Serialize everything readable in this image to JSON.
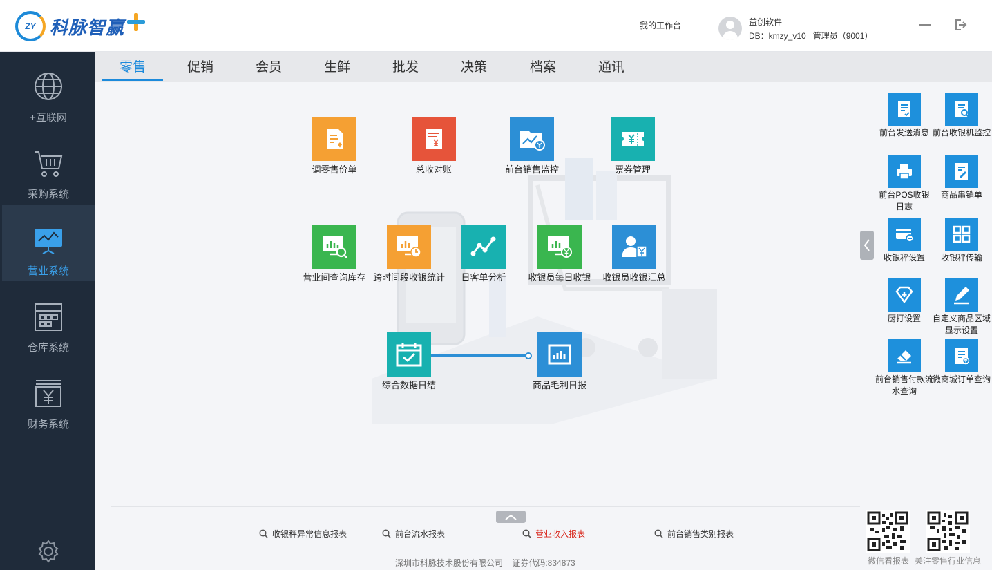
{
  "header": {
    "brand": "科脉智赢",
    "logo_mark": "ZY",
    "workbench_label": "我的工作台",
    "company_name": "益创软件",
    "db_info": "DB：kmzy_v10   管理员（9001）"
  },
  "sidebar": {
    "items": [
      {
        "label": "+互联网",
        "icon": "globe-icon"
      },
      {
        "label": "采购系统",
        "icon": "cart-icon"
      },
      {
        "label": "营业系统",
        "icon": "presentation-board-icon",
        "active": true
      },
      {
        "label": "仓库系统",
        "icon": "warehouse-icon"
      },
      {
        "label": "财务系统",
        "icon": "yen-ledger-icon"
      }
    ]
  },
  "tabs": [
    "零售",
    "促销",
    "会员",
    "生鲜",
    "批发",
    "决策",
    "档案",
    "通讯"
  ],
  "modules": [
    {
      "label": "调零售价单",
      "color": "#f5a033",
      "icon": "price-document-icon"
    },
    {
      "label": "总收对账",
      "color": "#e6543a",
      "icon": "yen-bill-icon"
    },
    {
      "label": "前台销售监控",
      "color": "#2c8fd6",
      "icon": "folder-chart-icon"
    },
    {
      "label": "票券管理",
      "color": "#18b1b0",
      "icon": "ticket-icon"
    },
    {
      "label": "营业间查询库存",
      "color": "#3ab64f",
      "icon": "monitor-search-icon"
    },
    {
      "label": "跨时间段收银统计",
      "color": "#f5a033",
      "icon": "monitor-clock-icon"
    },
    {
      "label": "日客单分析",
      "color": "#18b1b0",
      "icon": "line-trend-icon"
    },
    {
      "label": "收银员每日收银",
      "color": "#3ab64f",
      "icon": "monitor-yen-icon"
    },
    {
      "label": "收银员收银汇总",
      "color": "#2c8fd6",
      "icon": "cashier-yen-icon"
    },
    {
      "label": "综合数据日结",
      "color": "#18b1b0",
      "icon": "calendar-check-icon"
    },
    {
      "label": "商品毛利日报",
      "color": "#2c8fd6",
      "icon": "newspaper-chart-icon"
    }
  ],
  "quick_links": [
    {
      "label": "前台发送消息",
      "icon": "message-document-icon"
    },
    {
      "label": "前台收银机监控",
      "icon": "document-search-icon"
    },
    {
      "label": "前台POS收银日志",
      "icon": "printer-icon"
    },
    {
      "label": "商品串销单",
      "icon": "document-edit-icon"
    },
    {
      "label": "收银秤设置",
      "icon": "card-minus-icon"
    },
    {
      "label": "收银秤传输",
      "icon": "grid-four-icon"
    },
    {
      "label": "厨打设置",
      "icon": "diamond-tag-icon"
    },
    {
      "label": "自定义商品区域显示设置",
      "icon": "pencil-icon"
    },
    {
      "label": "前台销售付款流水查询",
      "icon": "eraser-icon"
    },
    {
      "label": "微商城订单查询",
      "icon": "document-upload-icon"
    }
  ],
  "footer": {
    "reports": [
      "收银秤异常信息报表",
      "前台流水报表",
      "营业收入报表",
      "前台销售类别报表"
    ],
    "copyright": "深圳市科脉技术股份有限公司    证券代码:834873",
    "qr_labels": [
      "微信看报表",
      "关注零售行业信息"
    ]
  },
  "colors": {
    "sidebar_bg": "#1f2b3a",
    "accent": "#1c8adb",
    "highlight_report": "#d9271c"
  }
}
